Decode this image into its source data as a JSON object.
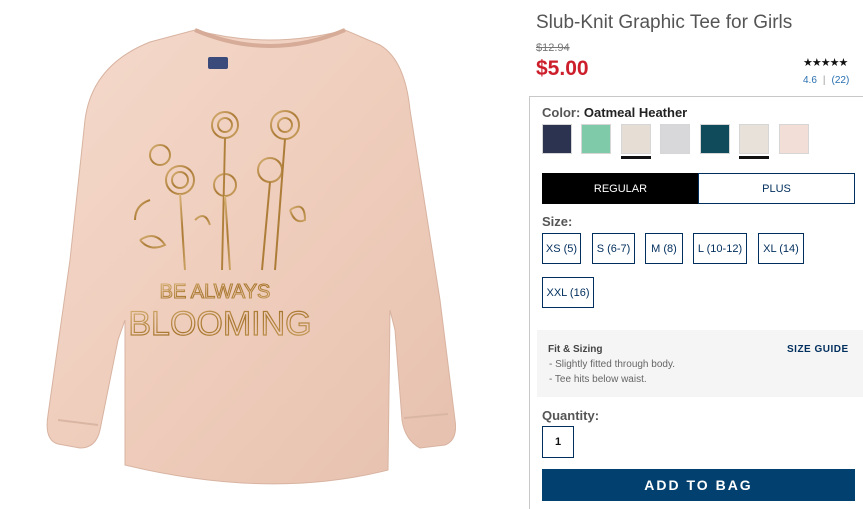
{
  "product": {
    "title": "Slub-Knit Graphic Tee for Girls",
    "old_price": "$12.94",
    "sale_price": "$5.00",
    "stars": "★★★★★",
    "rating": "4.6",
    "review_count": "(22)",
    "print_text_line1": "BE ALWAYS",
    "print_text_line2": "BLOOMING"
  },
  "color": {
    "label": "Color:",
    "selected": "Oatmeal Heather",
    "swatches": [
      {
        "name": "navy",
        "hex": "#2b3350"
      },
      {
        "name": "mint",
        "hex": "#7fcaa8"
      },
      {
        "name": "oatmeal-heather",
        "hex": "#e6ddd4"
      },
      {
        "name": "light-gray",
        "hex": "#d8d8da"
      },
      {
        "name": "teal",
        "hex": "#0f4b5a"
      },
      {
        "name": "oatmeal-2",
        "hex": "#e8e1d9"
      },
      {
        "name": "pink-heather",
        "hex": "#f3ded7"
      }
    ]
  },
  "fit": {
    "regular": "REGULAR",
    "plus": "PLUS"
  },
  "size": {
    "label": "Size:",
    "options": [
      "XS (5)",
      "S (6-7)",
      "M (8)",
      "L (10-12)",
      "XL (14)",
      "XXL (16)"
    ]
  },
  "fit_sizing": {
    "heading": "Fit & Sizing",
    "size_guide": "SIZE GUIDE",
    "line1": "- Slightly fitted through body.",
    "line2": "- Tee hits below waist."
  },
  "quantity": {
    "label": "Quantity:",
    "value": "1"
  },
  "add_to_bag": "ADD TO BAG",
  "colors": {
    "sale_red": "#cc1f2b",
    "navy_brand": "#002e5d",
    "button_blue": "#02416f",
    "shirt": "#efcfbf",
    "foil_gold": "#b88a44"
  }
}
